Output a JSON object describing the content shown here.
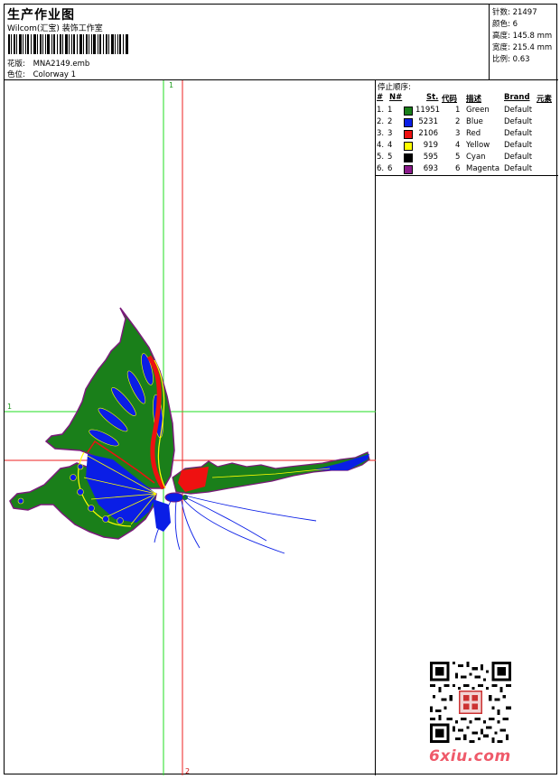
{
  "header": {
    "title": "生产作业图",
    "company": "Wilcom(汇宝) 装饰工作室",
    "design_label": "花版:",
    "design_value": "MNA2149.emb",
    "colorway_label": "色位:",
    "colorway_value": "Colorway 1"
  },
  "stats": [
    {
      "label": "针数:",
      "value": "21497"
    },
    {
      "label": "颜色:",
      "value": "6"
    },
    {
      "label": "高度:",
      "value": "145.8 mm"
    },
    {
      "label": "宽度:",
      "value": "215.4 mm"
    },
    {
      "label": "比例:",
      "value": "0.63"
    }
  ],
  "legend": {
    "title": "停止顺序:",
    "headers": {
      "num": "#",
      "n": "N#",
      "st": "St.",
      "code": "代码",
      "desc": "描述",
      "brand": "Brand",
      "elem": "元素"
    },
    "rows": [
      {
        "num": "1.",
        "n": "1",
        "color": "#1a7f1a",
        "st": "11951",
        "code": "1",
        "desc": "Green",
        "brand": "Default"
      },
      {
        "num": "2.",
        "n": "2",
        "color": "#0a1ee6",
        "st": "5231",
        "code": "2",
        "desc": "Blue",
        "brand": "Default"
      },
      {
        "num": "3.",
        "n": "3",
        "color": "#ee1111",
        "st": "2106",
        "code": "3",
        "desc": "Red",
        "brand": "Default"
      },
      {
        "num": "4.",
        "n": "4",
        "color": "#ffff00",
        "st": "919",
        "code": "4",
        "desc": "Yellow",
        "brand": "Default"
      },
      {
        "num": "5.",
        "n": "5",
        "color": "#000000",
        "st": "595",
        "code": "5",
        "desc": "Cyan",
        "brand": "Default"
      },
      {
        "num": "6.",
        "n": "6",
        "color": "#8a1a8a",
        "st": "693",
        "code": "6",
        "desc": "Magenta",
        "brand": "Default"
      }
    ]
  },
  "guides": {
    "v1": "1",
    "h1": "1",
    "v2": "2"
  },
  "footer": {
    "site": "6xiu.com"
  }
}
